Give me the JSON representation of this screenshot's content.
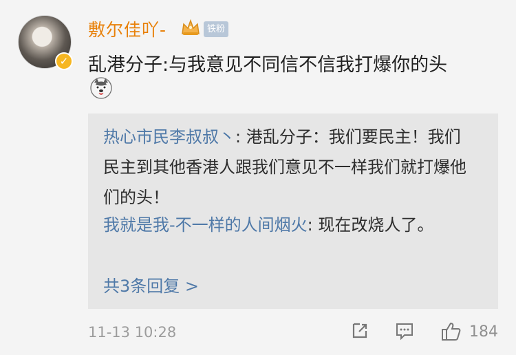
{
  "comment": {
    "username": "敷尔佳吖-",
    "fan_badge": "铁粉",
    "text": "乱港分子:与我意见不同信不信我打爆你的头",
    "emoji": "husky-emoji",
    "timestamp": "11-13 10:28",
    "likes": "184"
  },
  "replies": [
    {
      "user": "热心市民李叔叔丶",
      "text": ": 港乱分子：我们要民主！我们民主到其他香港人跟我们意见不一样我们就打爆他们的头！"
    },
    {
      "user": "我就是我-不一样的人间烟火",
      "text": ": 现在改烧人了。"
    }
  ],
  "more_replies_label": "共3条回复 >",
  "colors": {
    "username": "#e8810a",
    "link": "#4f79a8",
    "background": "#f4f4f4",
    "reply_box": "#e6e6e6"
  }
}
